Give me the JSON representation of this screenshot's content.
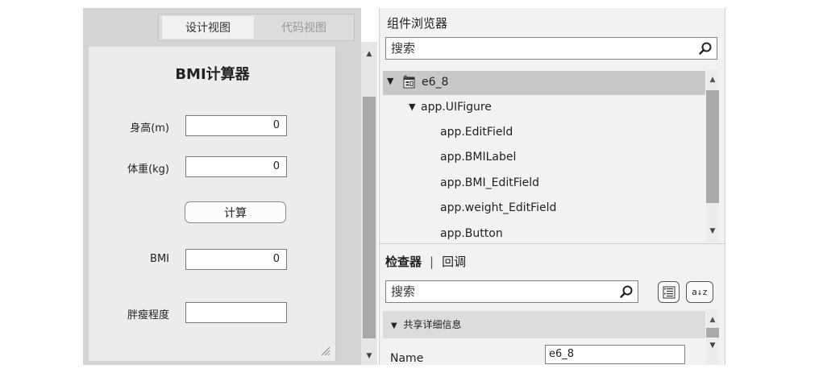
{
  "design_view": {
    "tabs": {
      "design": "设计视图",
      "code": "代码视图"
    },
    "app_title": "BMI计算器",
    "fields": [
      {
        "label": "身高(m)",
        "value": "0"
      },
      {
        "label": "体重(kg)",
        "value": "0"
      },
      {
        "label": "BMI",
        "value": "0"
      },
      {
        "label": "胖瘦程度",
        "value": ""
      }
    ],
    "button_label": "计算",
    "scroll_up": "▲",
    "scroll_down": "▼"
  },
  "component_browser": {
    "title": "组件浏览器",
    "search_placeholder": "搜索",
    "tree": {
      "root": {
        "expander": "▼",
        "label": "e6_8"
      },
      "figure": {
        "expander": "▼",
        "label": "app.UIFigure"
      },
      "children": [
        "app.EditField",
        "app.BMILabel",
        "app.BMI_EditField",
        "app.weight_EditField",
        "app.Button"
      ]
    },
    "scroll_up": "▲",
    "scroll_down": "▼"
  },
  "inspector": {
    "tab_active": "检查器",
    "separator": "|",
    "tab_callback": "回调",
    "search_placeholder": "搜索",
    "sort_icon_text": "a↓z",
    "section": {
      "expander": "▼",
      "title": "共享详细信息"
    },
    "properties": [
      {
        "name": "Name",
        "value": "e6_8"
      }
    ],
    "scroll_up": "▲",
    "scroll_down": "▼"
  },
  "icons": {
    "search": "magnifier-icon",
    "app": "app-file-icon",
    "group": "group-list-icon",
    "sort": "sort-alpha-icon",
    "resize": "resize-grip-icon"
  }
}
